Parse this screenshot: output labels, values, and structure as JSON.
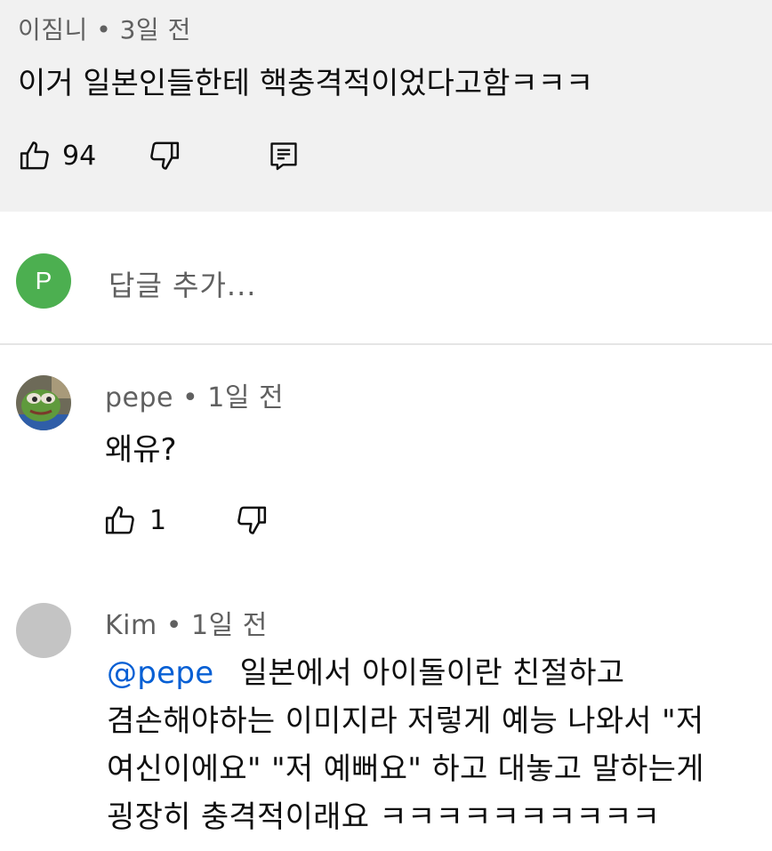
{
  "parent_comment": {
    "author": "이짐니",
    "time": "3일 전",
    "text": "이거 일본인들한테 핵충격적이었다고함ㅋㅋㅋ",
    "like_count": "94"
  },
  "reply_box": {
    "avatar_letter": "P",
    "placeholder": "답글 추가...",
    "avatar_color": "#4caf50"
  },
  "replies": [
    {
      "author": "pepe",
      "time": "1일 전",
      "text": "왜유?",
      "like_count": "1"
    },
    {
      "author": "Kim",
      "time": "1일 전",
      "mention": "@pepe",
      "line1": "일본에서 아이돌이란 친절하고",
      "line2": "겸손해야하는 이미지라 저렇게 예능 나와서 \"저",
      "line3": "여신이에요\" \"저 예뻐요\" 하고 대놓고 말하는게",
      "line4": "굉장히 충격적이래요 ㅋㅋㅋㅋㅋㅋㅋㅋㅋㅋ"
    }
  ],
  "icons": {
    "like": "thumbs-up-icon",
    "dislike": "thumbs-down-icon",
    "reply": "comment-icon"
  },
  "colors": {
    "mention": "#065fd4",
    "meta": "#606060",
    "parent_bg": "#f1f1f1"
  }
}
